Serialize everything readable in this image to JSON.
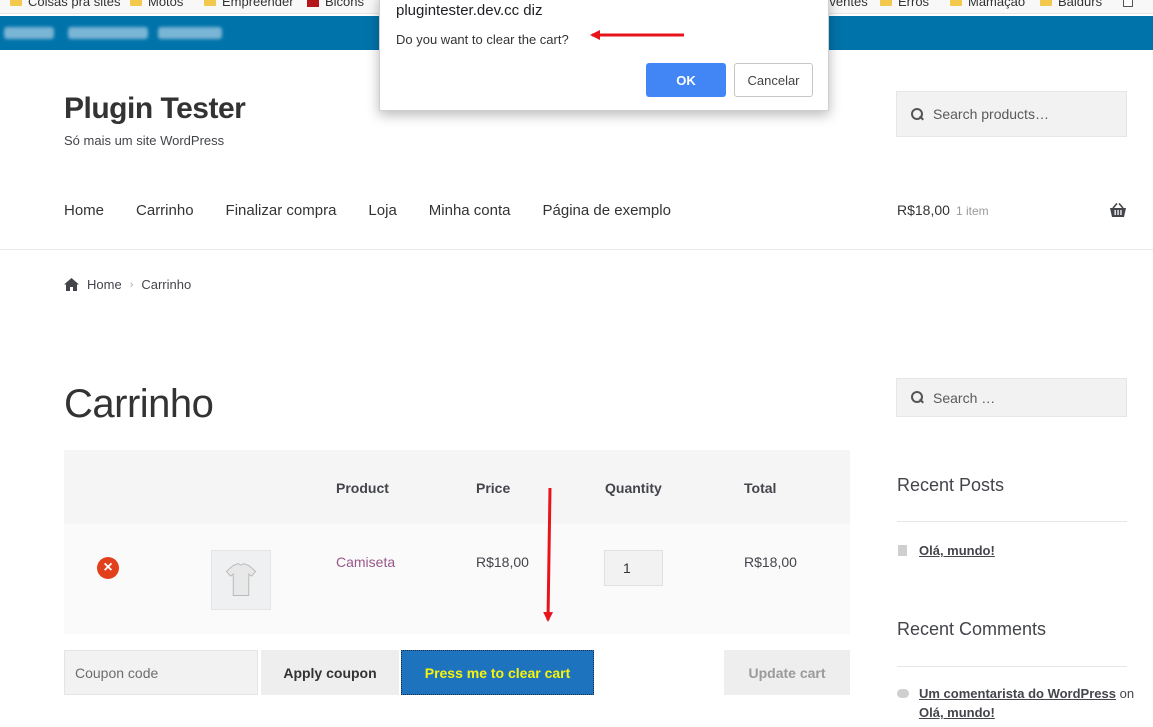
{
  "bookmarks": [
    {
      "label": "Coisas pra sites",
      "icon": "folder-icon"
    },
    {
      "label": "Motos",
      "icon": "folder-icon"
    },
    {
      "label": "Empreender",
      "icon": "folder-icon"
    },
    {
      "label": "Bicons",
      "icon": "bookmark-icon"
    },
    {
      "label": "viventes",
      "icon": "folder-icon"
    },
    {
      "label": "Erros",
      "icon": "folder-icon"
    },
    {
      "label": "Mamação",
      "icon": "folder-icon"
    },
    {
      "label": "Baldurs",
      "icon": "folder-icon"
    }
  ],
  "site": {
    "title": "Plugin Tester",
    "description": "Só mais um site WordPress",
    "search_placeholder": "Search products…"
  },
  "nav": {
    "items": [
      "Home",
      "Carrinho",
      "Finalizar compra",
      "Loja",
      "Minha conta",
      "Página de exemplo"
    ],
    "cart_total": "R$18,00",
    "cart_count": "1 item"
  },
  "breadcrumb": {
    "home": "Home",
    "current": "Carrinho"
  },
  "page": {
    "title": "Carrinho"
  },
  "cart": {
    "headers": {
      "product": "Product",
      "price": "Price",
      "quantity": "Quantity",
      "total": "Total"
    },
    "items": [
      {
        "product": "Camiseta",
        "price": "R$18,00",
        "quantity": "1",
        "total": "R$18,00"
      }
    ],
    "coupon_placeholder": "Coupon code",
    "apply_coupon": "Apply coupon",
    "clear_cart": "Press me to clear cart",
    "update_cart": "Update cart"
  },
  "sidebar": {
    "search_placeholder": "Search …",
    "recent_posts_title": "Recent Posts",
    "recent_posts": [
      "Olá, mundo!"
    ],
    "recent_comments_title": "Recent Comments",
    "comment_author": "Um comentarista do WordPress",
    "comment_on": "on",
    "comment_post": "Olá, mundo!"
  },
  "dialog": {
    "host": "plugintester.dev.cc diz",
    "message": "Do you want to clear the cart?",
    "ok": "OK",
    "cancel": "Cancelar"
  },
  "colors": {
    "admin_bar": "#0073aa",
    "clear_button_bg": "#1e73be",
    "clear_button_text": "#f7f30a",
    "remove_icon": "#e2401c",
    "product_link": "#96588a",
    "dialog_ok": "#4285f4",
    "annotation_arrow": "#e8141b"
  }
}
